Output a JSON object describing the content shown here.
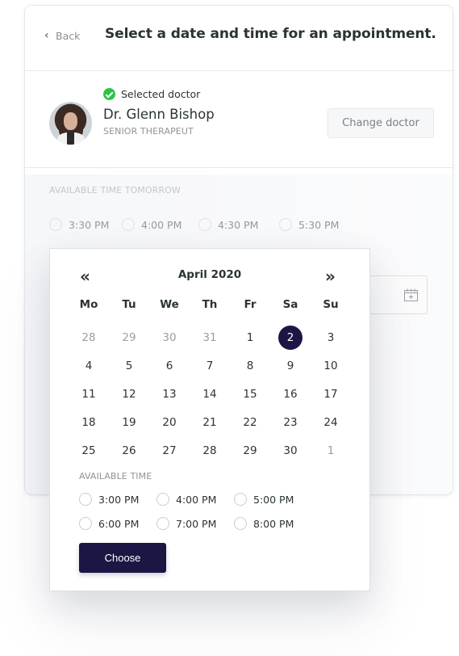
{
  "header": {
    "back_label": "Back",
    "title": "Select a date and time for an appointment."
  },
  "doctor": {
    "status_label": "Selected doctor",
    "name": "Dr. Glenn Bishop",
    "role": "SENIOR THERAPEUT",
    "change_button": "Change doctor"
  },
  "tomorrow": {
    "label": "AVAILABLE TIME TOMORROW",
    "options": [
      "3:30 PM",
      "4:00 PM",
      "4:30 PM",
      "5:30 PM"
    ]
  },
  "date_input": {
    "icon": "calendar-plus-icon"
  },
  "calendar": {
    "prev_icon": "«",
    "next_icon": "»",
    "month": "April 2020",
    "weekdays": [
      "Mo",
      "Tu",
      "We",
      "Th",
      "Fr",
      "Sa",
      "Su"
    ],
    "weeks": [
      [
        "28",
        "29",
        "30",
        "31",
        "1",
        "2",
        "3"
      ],
      [
        "4",
        "5",
        "6",
        "7",
        "8",
        "9",
        "10"
      ],
      [
        "11",
        "12",
        "13",
        "14",
        "15",
        "16",
        "17"
      ],
      [
        "18",
        "19",
        "20",
        "21",
        "22",
        "23",
        "24"
      ],
      [
        "25",
        "26",
        "27",
        "28",
        "29",
        "30",
        "1"
      ]
    ],
    "muted_days": [
      "0-0",
      "0-1",
      "0-2",
      "0-3",
      "4-6"
    ],
    "selected_day": "0-5",
    "selected_color": "#1b1644",
    "available_label": "AVAILABLE TIME",
    "available_times": [
      "3:00 PM",
      "4:00 PM",
      "5:00 PM",
      "6:00 PM",
      "7:00 PM",
      "8:00 PM"
    ],
    "choose_button": "Choose"
  },
  "colors": {
    "accent": "#1b1644",
    "success": "#2fc346"
  }
}
